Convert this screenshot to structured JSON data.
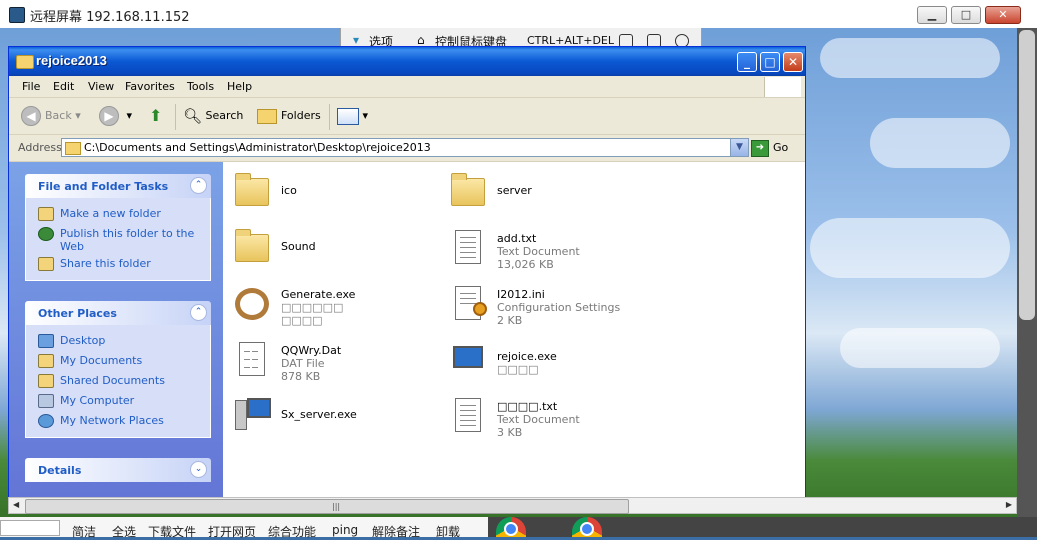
{
  "remote": {
    "title": "远程屏幕 192.168.11.152",
    "buttons": {
      "minimize": "▁",
      "maximize": "□",
      "close": "✕"
    },
    "toolbar": {
      "options": "选项",
      "control": "控制鼠标键盘",
      "cad": "CTRL+ALT+DEL"
    }
  },
  "explorer": {
    "title": "rejoice2013",
    "menu": [
      "File",
      "Edit",
      "View",
      "Favorites",
      "Tools",
      "Help"
    ],
    "toolbar": {
      "back": "Back",
      "search": "Search",
      "folders": "Folders"
    },
    "address": {
      "label": "Address",
      "value": "C:\\Documents and Settings\\Administrator\\Desktop\\rejoice2013",
      "go": "Go"
    },
    "tasks": {
      "header": "File and Folder Tasks",
      "items": [
        "Make a new folder",
        "Publish this folder to the Web",
        "Share this folder"
      ]
    },
    "places": {
      "header": "Other Places",
      "items": [
        "Desktop",
        "My Documents",
        "Shared Documents",
        "My Computer",
        "My Network Places"
      ]
    },
    "details": {
      "header": "Details"
    },
    "files": [
      {
        "name": "ico",
        "desc": "",
        "size": ""
      },
      {
        "name": "server",
        "desc": "",
        "size": ""
      },
      {
        "name": "Sound",
        "desc": "",
        "size": ""
      },
      {
        "name": "add.txt",
        "desc": "Text Document",
        "size": "13,026 KB"
      },
      {
        "name": "Generate.exe",
        "desc": "□□□□□□",
        "size": "□□□□"
      },
      {
        "name": "I2012.ini",
        "desc": "Configuration Settings",
        "size": "2 KB"
      },
      {
        "name": "QQWry.Dat",
        "desc": "DAT File",
        "size": "878 KB"
      },
      {
        "name": "rejoice.exe",
        "desc": "□□□□",
        "size": ""
      },
      {
        "name": "Sx_server.exe",
        "desc": "",
        "size": ""
      },
      {
        "name": "□□□□.txt",
        "desc": "Text Document",
        "size": "3 KB"
      }
    ]
  },
  "taskbar": {
    "items": [
      "简洁",
      "全选",
      "下载文件",
      "打开网页",
      "综合功能",
      "ping",
      "解除备注",
      "卸载"
    ]
  }
}
